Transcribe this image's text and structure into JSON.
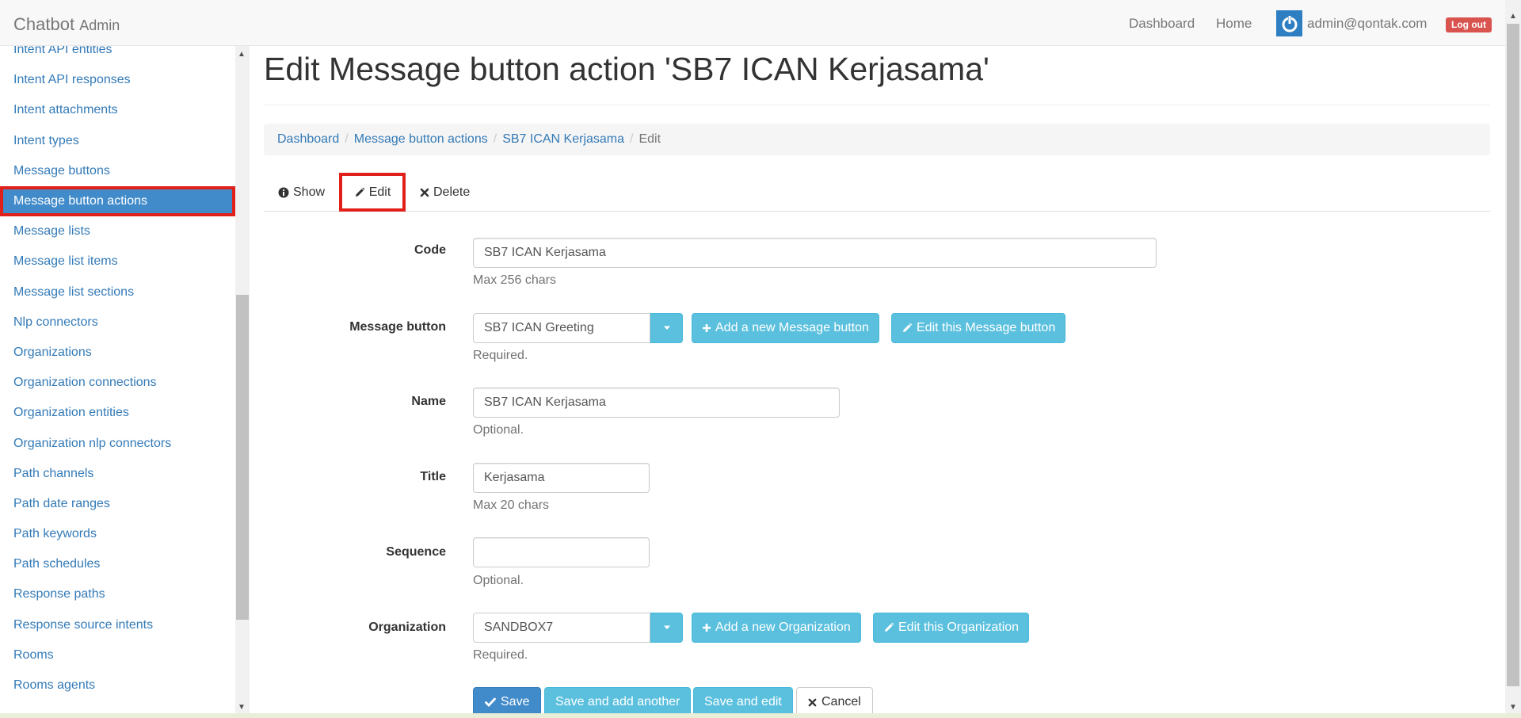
{
  "navbar": {
    "brand": "Chatbot",
    "brand_sub": "Admin",
    "links": [
      "Dashboard",
      "Home"
    ],
    "user_email": "admin@qontak.com",
    "logout_label": "Log out",
    "avatar_icon": "power-icon",
    "avatar_color": "#2e7fc2"
  },
  "sidebar": {
    "items": [
      {
        "label": "Intent API entities"
      },
      {
        "label": "Intent API responses"
      },
      {
        "label": "Intent attachments"
      },
      {
        "label": "Intent types"
      },
      {
        "label": "Message buttons"
      },
      {
        "label": "Message button actions",
        "active": true
      },
      {
        "label": "Message lists"
      },
      {
        "label": "Message list items"
      },
      {
        "label": "Message list sections"
      },
      {
        "label": "Nlp connectors"
      },
      {
        "label": "Organizations"
      },
      {
        "label": "Organization connections"
      },
      {
        "label": "Organization entities"
      },
      {
        "label": "Organization nlp connectors"
      },
      {
        "label": "Path channels"
      },
      {
        "label": "Path date ranges"
      },
      {
        "label": "Path keywords"
      },
      {
        "label": "Path schedules"
      },
      {
        "label": "Response paths"
      },
      {
        "label": "Response source intents"
      },
      {
        "label": "Rooms"
      },
      {
        "label": "Rooms agents"
      }
    ]
  },
  "page": {
    "title": "Edit Message button action 'SB7 ICAN Kerjasama'"
  },
  "breadcrumb": {
    "items": [
      "Dashboard",
      "Message button actions",
      "SB7 ICAN Kerjasama",
      "Edit"
    ]
  },
  "tabs": {
    "show": "Show",
    "edit": "Edit",
    "delete": "Delete"
  },
  "form": {
    "code": {
      "label": "Code",
      "value": "SB7 ICAN Kerjasama",
      "help": "Max 256 chars"
    },
    "message_button": {
      "label": "Message button",
      "value": "SB7 ICAN Greeting",
      "help": "Required.",
      "add_label": "Add a new Message button",
      "edit_label": "Edit this Message button"
    },
    "name": {
      "label": "Name",
      "value": "SB7 ICAN Kerjasama",
      "help": "Optional."
    },
    "title": {
      "label": "Title",
      "value": "Kerjasama",
      "help": "Max 20 chars"
    },
    "sequence": {
      "label": "Sequence",
      "value": "",
      "help": "Optional."
    },
    "organization": {
      "label": "Organization",
      "value": "SANDBOX7",
      "help": "Required.",
      "add_label": "Add a new Organization",
      "edit_label": "Edit this Organization"
    }
  },
  "actions": {
    "save": "Save",
    "save_add_another": "Save and add another",
    "save_edit": "Save and edit",
    "cancel": "Cancel"
  },
  "colors": {
    "primary": "#428bca",
    "info": "#5bc0de",
    "danger": "#d9534f",
    "highlight_outline": "#e0211b",
    "link": "#337ab7"
  }
}
